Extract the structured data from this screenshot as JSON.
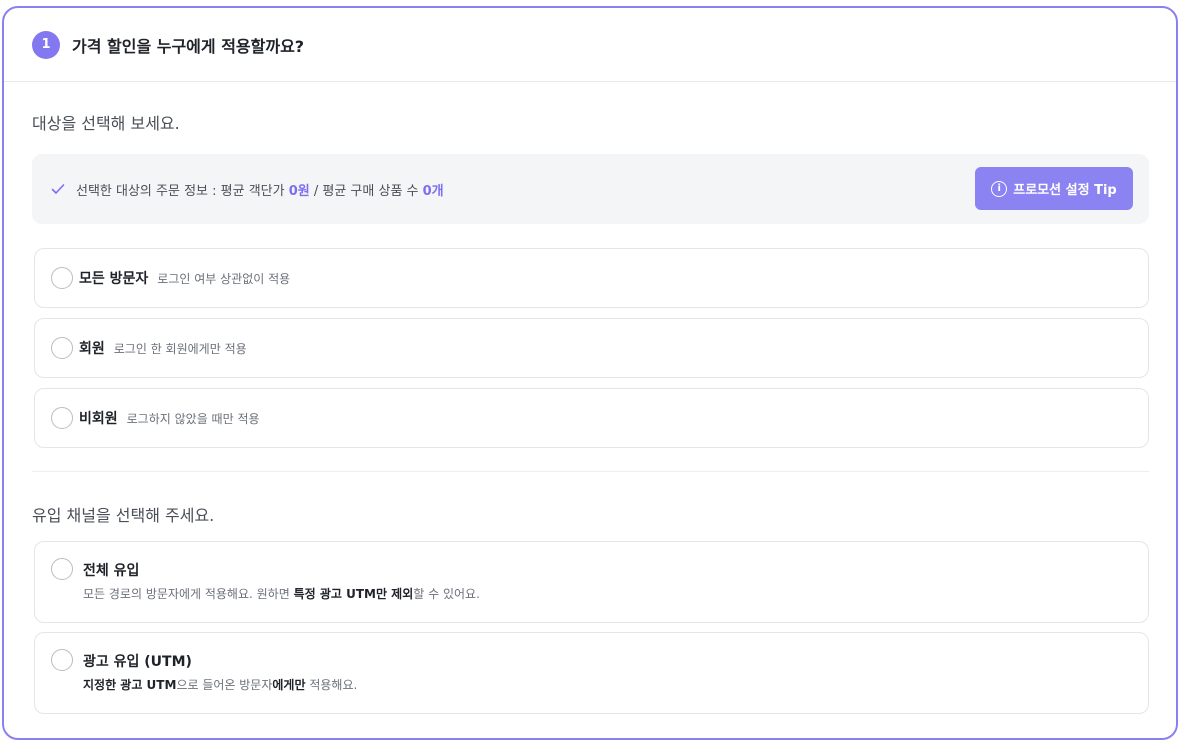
{
  "header": {
    "step": "1",
    "title": "가격 할인을 누구에게 적용할까요?"
  },
  "target_section": {
    "title": "대상을 선택해 보세요.",
    "info": {
      "prefix": "선택한 대상의 주문 정보 : 평균 객단가 ",
      "avg_order_value": "0원",
      "middle": " / 평균 구매 상품 수 ",
      "avg_item_count": "0개"
    },
    "tip_button": "프로모션 설정 Tip",
    "options": [
      {
        "label": "모든 방문자",
        "desc": "로그인 여부 상관없이 적용"
      },
      {
        "label": "회원",
        "desc": "로그인 한 회원에게만 적용"
      },
      {
        "label": "비회원",
        "desc": "로그하지 않았을 때만 적용"
      }
    ]
  },
  "channel_section": {
    "title": "유입 채널을 선택해 주세요.",
    "options": [
      {
        "title": "전체 유입",
        "desc_a": "모든 경로의 방문자에게 적용해요. 원하면 ",
        "desc_bold": "특정 광고 UTM만 제외",
        "desc_b": "할 수 있어요."
      },
      {
        "title": "광고 유입 (UTM)",
        "desc_bold_a": "지정한 광고 UTM",
        "desc_mid": "으로 들어온 방문자",
        "desc_bold_b": "에게만",
        "desc_end": " 적용해요."
      }
    ]
  },
  "colors": {
    "accent": "#8378f0",
    "border": "#8b80f0",
    "tip_button": "#8c83f2"
  }
}
